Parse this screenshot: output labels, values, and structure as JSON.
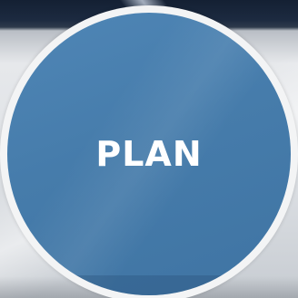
{
  "badge": {
    "label": "PLAN",
    "fill_color": "#467cab",
    "ring_color": "#f3f4f5",
    "text_color": "#ffffff"
  },
  "background": {
    "top_color": "#1c2a40",
    "base_color": "#dfe2e6"
  }
}
